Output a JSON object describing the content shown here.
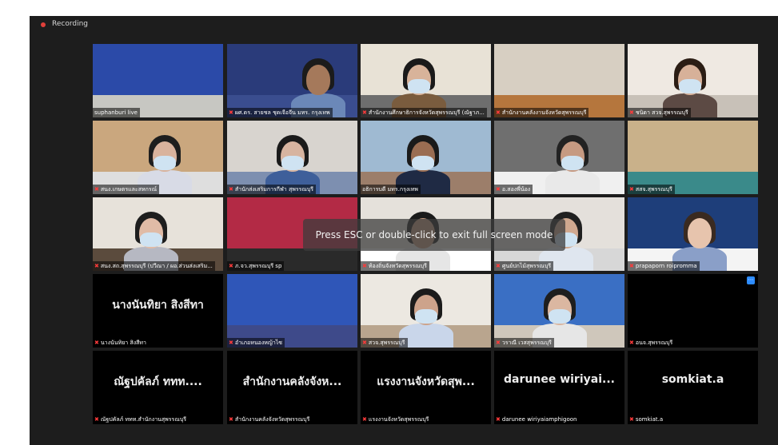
{
  "topbar": {
    "recording_label": "Recording"
  },
  "overlay": {
    "message": "Press ESC or double-click to exit full screen mode"
  },
  "participants": [
    {
      "name": "suphanburi live",
      "big_name": "",
      "muted": false,
      "highlighted": true
    },
    {
      "name": "ผศ.ดร. สายชล ชุดเจือจีน มทร. กรุงเทพ",
      "big_name": "",
      "muted": true,
      "highlighted": false
    },
    {
      "name": "สำนักงานศึกษาธิการจังหวัดสุพรรณบุรี (ณัฐาภ...",
      "big_name": "",
      "muted": true,
      "highlighted": false
    },
    {
      "name": "สำนักงานคลังงานจังหวัดสุพรรณบุรี",
      "big_name": "",
      "muted": true,
      "highlighted": false
    },
    {
      "name": "ชนิดา สวจ.สุพรรณบุรี",
      "big_name": "",
      "muted": true,
      "highlighted": false
    },
    {
      "name": "สนง.เกษตรและสหกรณ์",
      "big_name": "",
      "muted": true,
      "highlighted": false
    },
    {
      "name": "สำนักส่งเสริมการกีฬา สุพรรณบุรี",
      "big_name": "",
      "muted": true,
      "highlighted": false
    },
    {
      "name": "อธิการบดี มทร.กรุงเทพ",
      "big_name": "",
      "muted": false,
      "highlighted": false
    },
    {
      "name": "อ.สองพี่น้อง",
      "big_name": "",
      "muted": true,
      "highlighted": false
    },
    {
      "name": "สสจ.สุพรรณบุรี",
      "big_name": "",
      "muted": true,
      "highlighted": false
    },
    {
      "name": "สนง.สถ.สุพรรณบุรี (ปวีณา / ผอ.ส่วนส่งเสริม...",
      "big_name": "",
      "muted": true,
      "highlighted": false
    },
    {
      "name": "ภ.จว.สุพรรณบุรี sp",
      "big_name": "",
      "muted": true,
      "highlighted": false
    },
    {
      "name": "ท้องถิ่นจังหวัดสุพรรณบุรี",
      "big_name": "",
      "muted": true,
      "highlighted": false
    },
    {
      "name": "ศูนย์ปกไม้สุพรรณบุรี",
      "big_name": "",
      "muted": true,
      "highlighted": false
    },
    {
      "name": "prapaporn roipromma",
      "big_name": "",
      "muted": true,
      "highlighted": false
    },
    {
      "name": "นางนันทิยา สิงสีทา",
      "big_name": "นางนันทิยา สิงสีทา",
      "muted": true,
      "highlighted": false
    },
    {
      "name": "อำเภอหนองหญ้าไซ",
      "big_name": "",
      "muted": true,
      "highlighted": false
    },
    {
      "name": "สวจ.สุพรรณบุรี",
      "big_name": "",
      "muted": true,
      "highlighted": false
    },
    {
      "name": "วราณี เวสสุพรรณบุรี",
      "big_name": "",
      "muted": true,
      "highlighted": false
    },
    {
      "name": "อนจ.สุพรรณบุรี",
      "big_name": "",
      "muted": true,
      "highlighted": false
    },
    {
      "name": "ณัฐปคัลภ์ ททท.สำนักงานสุพรรณบุรี",
      "big_name": "ณัฐปคัลภ์ ททท....",
      "muted": true,
      "highlighted": false
    },
    {
      "name": "สำนักงานคลังจังหวัดสุพรรณบุรี",
      "big_name": "สำนักงานคลังจังห...",
      "muted": true,
      "highlighted": false
    },
    {
      "name": "แรงงานจังหวัดสุพรรณบุรี",
      "big_name": "แรงงานจังหวัดสุพ...",
      "muted": true,
      "highlighted": false
    },
    {
      "name": "darunee wiriyaiamphigoon",
      "big_name": "darunee wiriyai...",
      "muted": true,
      "highlighted": false
    },
    {
      "name": "somkiat.a",
      "big_name": "somkiat.a",
      "muted": true,
      "highlighted": false
    }
  ],
  "icons": {
    "muted_mic": "mic-off-icon",
    "more_options": "more-options-icon",
    "recording": "recording-dot-icon"
  },
  "colors": {
    "background": "#1d1d1d",
    "tile": "#000000",
    "active_speaker_border": "#c9e85a",
    "muted_icon": "#ff3b3b",
    "recording_dot": "#e0403a",
    "more_button": "#2d8cff"
  }
}
